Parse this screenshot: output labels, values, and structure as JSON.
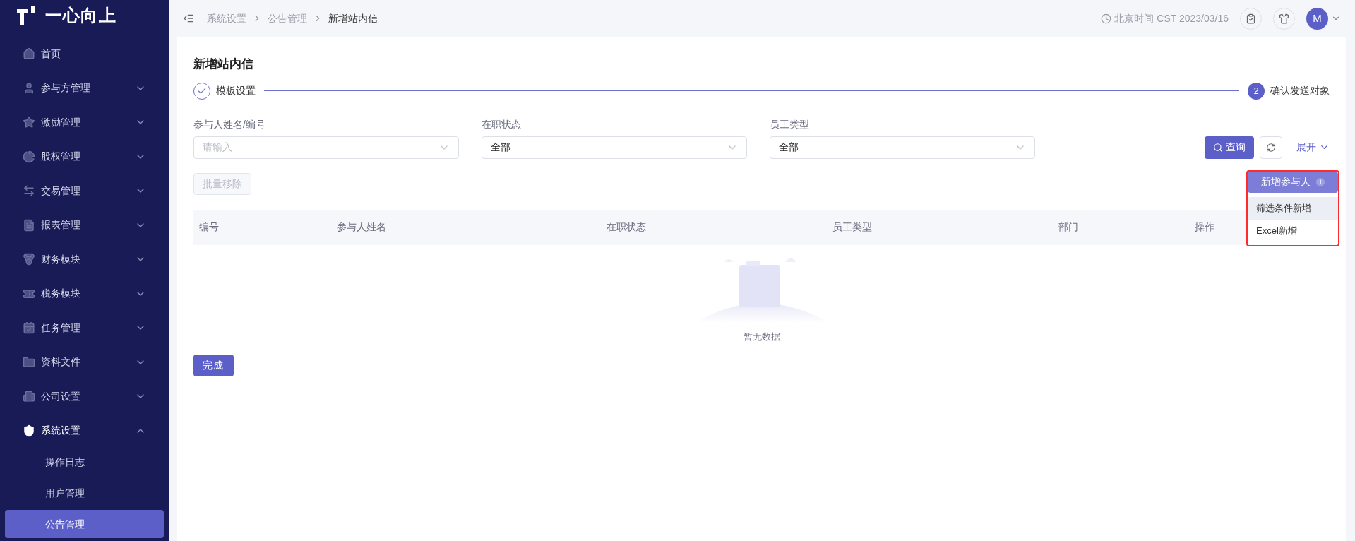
{
  "logo": {
    "text": "一心向上"
  },
  "sidebar": {
    "items": [
      {
        "label": "首页",
        "expanded": false
      },
      {
        "label": "参与方管理",
        "expanded": false
      },
      {
        "label": "激励管理",
        "expanded": false
      },
      {
        "label": "股权管理",
        "expanded": false
      },
      {
        "label": "交易管理",
        "expanded": false
      },
      {
        "label": "报表管理",
        "expanded": false
      },
      {
        "label": "财务模块",
        "expanded": false
      },
      {
        "label": "税务模块",
        "expanded": false
      },
      {
        "label": "任务管理",
        "expanded": false
      },
      {
        "label": "资料文件",
        "expanded": false
      },
      {
        "label": "公司设置",
        "expanded": false
      },
      {
        "label": "系统设置",
        "expanded": true,
        "children": [
          {
            "label": "操作日志",
            "selected": false
          },
          {
            "label": "用户管理",
            "selected": false
          },
          {
            "label": "公告管理",
            "selected": true
          }
        ]
      }
    ]
  },
  "breadcrumb": [
    "系统设置",
    "公告管理",
    "新增站内信"
  ],
  "header": {
    "time": "北京时间 CST 2023/03/16",
    "avatar": "M"
  },
  "page_title": "新增站内信",
  "steps": [
    {
      "label": "模板设置",
      "completed": true
    },
    {
      "label": "确认发送对象",
      "number": "2",
      "completed": false
    }
  ],
  "filters": [
    {
      "label": "参与人姓名/编号",
      "placeholder": "请输入"
    },
    {
      "label": "在职状态",
      "value": "全部"
    },
    {
      "label": "员工类型",
      "value": "全部"
    }
  ],
  "search_button": "查询",
  "expand_link": "展开",
  "batch_remove": {
    "label": "批量移除",
    "disabled": true
  },
  "add_menu": {
    "label": "新增参与人",
    "items": [
      {
        "label": "筛选条件新增",
        "selected": true
      },
      {
        "label": "Excel新增",
        "selected": false
      }
    ]
  },
  "table": {
    "columns": [
      "编号",
      "参与人姓名",
      "在职状态",
      "员工类型",
      "部门",
      "操作"
    ],
    "empty_text": "暂无数据"
  },
  "finish_button": "完成"
}
